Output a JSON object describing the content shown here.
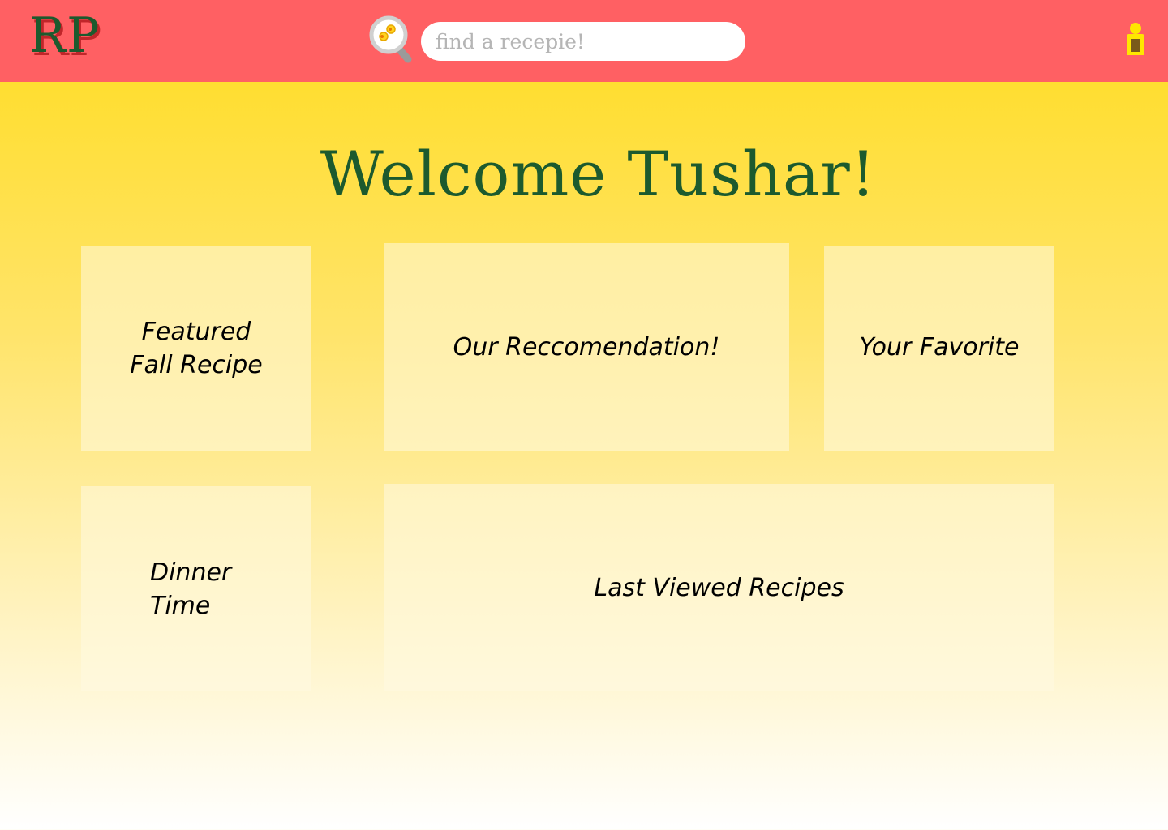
{
  "header": {
    "logo_text": "RP",
    "search": {
      "placeholder": "find a recepie!",
      "icon": "magnifier-icon"
    },
    "user_icon": "user-icon",
    "colors": {
      "bar": "#FF6063",
      "logo": "#1C5A2E",
      "logo_shadow": "#C0262A"
    }
  },
  "main": {
    "welcome": "Welcome Tushar!",
    "cards": {
      "featured": "Featured\nFall Recipe",
      "recommendation": "Our Reccomendation!",
      "favorite": "Your Favorite",
      "dinner": "Dinner\nTime",
      "last_viewed": "Last Viewed Recipes"
    },
    "colors": {
      "welcome": "#1C5A2E",
      "background_top": "#FFDC1E",
      "background_bottom": "#FFFFFF"
    }
  }
}
